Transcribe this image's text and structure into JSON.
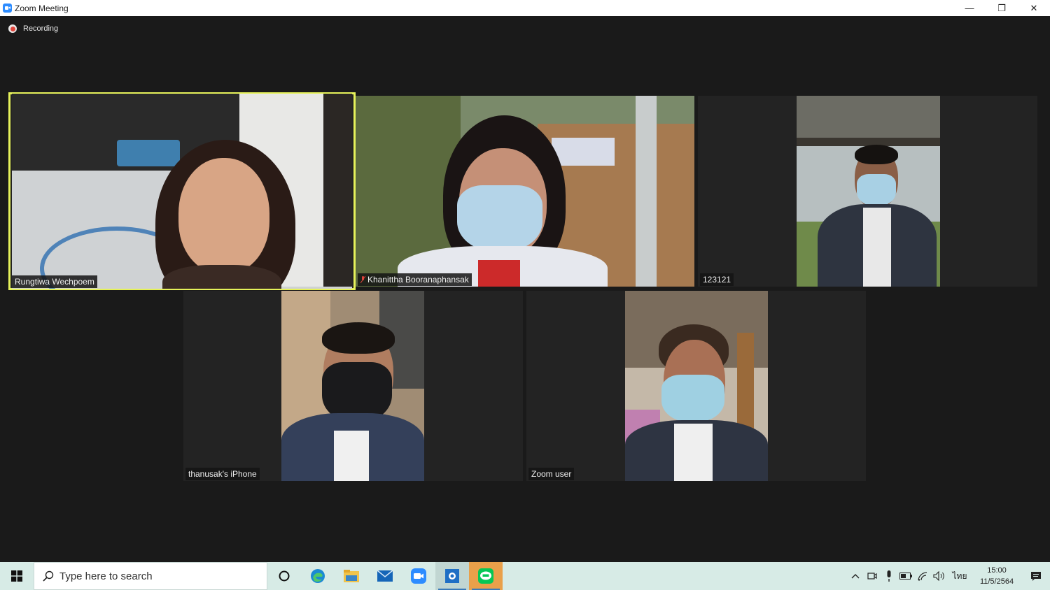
{
  "window": {
    "title": "Zoom Meeting",
    "minimize": "—",
    "restore": "❐",
    "close": "✕"
  },
  "recording": {
    "label": "Recording"
  },
  "participants": [
    {
      "name": "Rungtiwa Wechpoem",
      "active_speaker": true,
      "muted": false
    },
    {
      "name": "Khanittha Booranaphansak",
      "active_speaker": false,
      "muted": true
    },
    {
      "name": "123121",
      "active_speaker": false,
      "muted": false
    },
    {
      "name": "thanusak's iPhone",
      "active_speaker": false,
      "muted": false
    },
    {
      "name": "Zoom user",
      "active_speaker": false,
      "muted": false
    }
  ],
  "taskbar": {
    "search_placeholder": "Type here to search",
    "apps": [
      "cortana-icon",
      "edge-icon",
      "file-explorer-icon",
      "mail-icon",
      "zoom-icon",
      "store-icon",
      "line-icon"
    ],
    "language": "ไทย",
    "time": "15:00",
    "date": "11/5/2564"
  },
  "colors": {
    "active_speaker_border": "#e6f25a",
    "meeting_bg": "#1a1a1a",
    "taskbar_bg": "#d7ebe6",
    "zoom_blue": "#2d8cff",
    "line_green": "#06c755",
    "recording_red": "#e0453c"
  }
}
